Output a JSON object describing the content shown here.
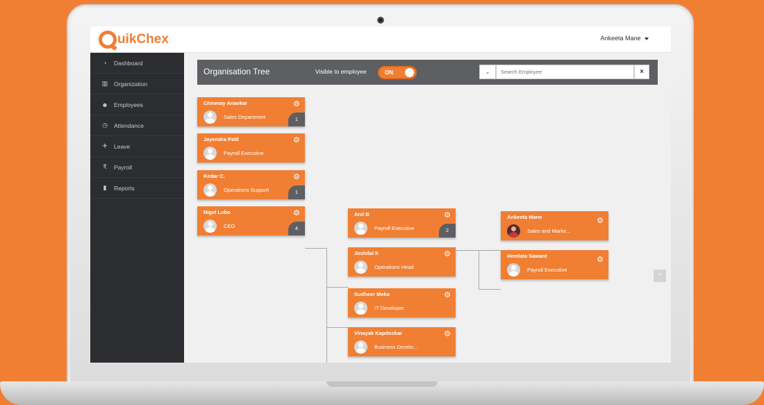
{
  "app": {
    "logo_text": "uikChex",
    "user_name": "Ankeeta Mane"
  },
  "sidebar": {
    "items": [
      {
        "label": "Dashboard",
        "icon": "dashboard-icon"
      },
      {
        "label": "Organization",
        "icon": "bank-icon"
      },
      {
        "label": "Employees",
        "icon": "users-icon"
      },
      {
        "label": "Attendance",
        "icon": "clock-icon"
      },
      {
        "label": "Leave",
        "icon": "plane-icon"
      },
      {
        "label": "Payroll",
        "icon": "rupee-icon"
      },
      {
        "label": "Reports",
        "icon": "bar-chart-icon"
      }
    ]
  },
  "header": {
    "title": "Organisation Tree",
    "visible_label": "Visible to employee",
    "toggle_label": "ON",
    "search_placeholder": "Search Employee",
    "clear_label": "×",
    "dropdown_label": "⌄"
  },
  "tree": {
    "chinmay": {
      "name": "Chinmay Anavkar",
      "role": "Sales Department",
      "count": "1"
    },
    "jayendra": {
      "name": "Jayendra Patil",
      "role": "Payroll Executive"
    },
    "kedar": {
      "name": "Kedar C.",
      "role": "Operations Support",
      "count": "1"
    },
    "nigel": {
      "name": "Nigel Lobo",
      "role": "CEO",
      "count": "4"
    },
    "anil": {
      "name": "Anil B",
      "role": "Payroll Executive",
      "count": "2"
    },
    "joshilal": {
      "name": "Joshilal K",
      "role": "Operations Head"
    },
    "sudheer": {
      "name": "Sudheer Meka",
      "role": "IT Developer"
    },
    "vinayak": {
      "name": "Vinayak Kapdoskar",
      "role": "Business Develo..."
    },
    "ankeeta": {
      "name": "Ankeeta Mane",
      "role": "Sales and Marke..."
    },
    "hemlata": {
      "name": "Hemlata Sawant",
      "role": "Payroll Executive"
    }
  },
  "colors": {
    "accent": "#f07f34",
    "sidebar_bg": "#2b2d31",
    "header_bg": "#5d5f63"
  }
}
